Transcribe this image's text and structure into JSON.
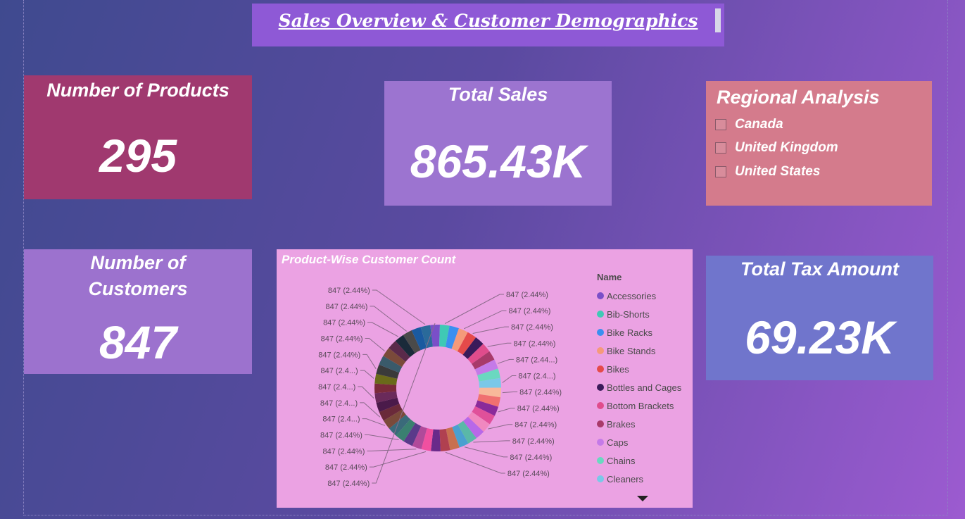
{
  "header": {
    "title": "Sales Overview & Customer Demographics"
  },
  "cards": {
    "products": {
      "title": "Number of Products",
      "value": "295"
    },
    "sales": {
      "title": "Total Sales",
      "value": "865.43K"
    },
    "customers": {
      "title_line1": "Number of",
      "title_line2": "Customers",
      "value": "847"
    },
    "tax": {
      "title": "Total Tax Amount",
      "value": "69.23K"
    }
  },
  "regional": {
    "title": "Regional Analysis",
    "options": [
      {
        "label": "Canada",
        "checked": false
      },
      {
        "label": "United Kingdom",
        "checked": false
      },
      {
        "label": "United States",
        "checked": false
      }
    ]
  },
  "chart": {
    "title": "Product-Wise Customer Count",
    "legend_title": "Name",
    "legend_items": [
      {
        "label": "Accessories",
        "color": "#7a4fc8"
      },
      {
        "label": "Bib-Shorts",
        "color": "#3fc9b5"
      },
      {
        "label": "Bike Racks",
        "color": "#3a8ff0"
      },
      {
        "label": "Bike Stands",
        "color": "#f59a7a"
      },
      {
        "label": "Bikes",
        "color": "#e54a4a"
      },
      {
        "label": "Bottles and Cages",
        "color": "#3a1a5a"
      },
      {
        "label": "Bottom Brackets",
        "color": "#e04c8c"
      },
      {
        "label": "Brakes",
        "color": "#a83a6a"
      },
      {
        "label": "Caps",
        "color": "#c47ae8"
      },
      {
        "label": "Chains",
        "color": "#6ad8c0"
      },
      {
        "label": "Cleaners",
        "color": "#7ac8e8"
      }
    ],
    "more_icon": "chevron-down-icon"
  },
  "chart_data": {
    "type": "pie",
    "variant": "donut",
    "title": "Product-Wise Customer Count",
    "legend_title": "Name",
    "categories": [
      "Accessories",
      "Bib-Shorts",
      "Bike Racks",
      "Bike Stands",
      "Bikes",
      "Bottles and Cages",
      "Bottom Brackets",
      "Brakes",
      "Caps",
      "Chains",
      "Cleaners"
    ],
    "slice_count": 41,
    "values": [
      847,
      847,
      847,
      847,
      847,
      847,
      847,
      847,
      847,
      847,
      847,
      847,
      847,
      847,
      847,
      847,
      847,
      847,
      847,
      847,
      847,
      847,
      847,
      847,
      847,
      847,
      847,
      847,
      847,
      847,
      847,
      847,
      847,
      847,
      847,
      847,
      847,
      847,
      847,
      847,
      847
    ],
    "percent_each": 2.44,
    "colors": [
      "#7a4fc8",
      "#3fc9b5",
      "#3a8ff0",
      "#f59a7a",
      "#e54a4a",
      "#3a1a5a",
      "#e04c8c",
      "#a83a6a",
      "#c47ae8",
      "#6ad8c0",
      "#7ac8e8",
      "#f8b89a",
      "#f07070",
      "#8a2a9a",
      "#e0509a",
      "#f088c0",
      "#b868e8",
      "#5ab8a8",
      "#4aa0d0",
      "#c87050",
      "#b04050",
      "#6a2a8a",
      "#f050a0",
      "#b04a9a",
      "#5a3a8a",
      "#3a8070",
      "#3a6a7a",
      "#7a4a3a",
      "#6a2a3a",
      "#4a1a4a",
      "#6a2a5a",
      "#7a2a3a",
      "#6a6a1a",
      "#3a3a3a",
      "#3a5a6a",
      "#7a4a3a",
      "#5a2a4a",
      "#1a2a3a",
      "#4a4a4a",
      "#1a5aa0",
      "#2a6a9a"
    ],
    "labels": [
      {
        "text": "847 (2.44%)",
        "side": "right"
      },
      {
        "text": "847 (2.44%)",
        "side": "right"
      },
      {
        "text": "847 (2.44%)",
        "side": "right"
      },
      {
        "text": "847 (2.44%)",
        "side": "right"
      },
      {
        "text": "847 (2.44...)",
        "side": "right"
      },
      {
        "text": "847 (2.4...)",
        "side": "right"
      },
      {
        "text": "847 (2.44%)",
        "side": "right"
      },
      {
        "text": "847 (2.44%)",
        "side": "right"
      },
      {
        "text": "847 (2.44%)",
        "side": "right"
      },
      {
        "text": "847 (2.44%)",
        "side": "right"
      },
      {
        "text": "847 (2.44%)",
        "side": "right"
      },
      {
        "text": "847 (2.44%)",
        "side": "right"
      },
      {
        "text": "847 (2.44%)",
        "side": "left"
      },
      {
        "text": "847 (2.44%)",
        "side": "left"
      },
      {
        "text": "847 (2.44%)",
        "side": "left"
      },
      {
        "text": "847 (2.44%)",
        "side": "left"
      },
      {
        "text": "847 (2.4...)",
        "side": "left"
      },
      {
        "text": "847 (2.4...)",
        "side": "left"
      },
      {
        "text": "847 (2.4...)",
        "side": "left"
      },
      {
        "text": "847 (2.4...)",
        "side": "left"
      },
      {
        "text": "847 (2.44%)",
        "side": "left"
      },
      {
        "text": "847 (2.44%)",
        "side": "left"
      },
      {
        "text": "847 (2.44%)",
        "side": "left"
      },
      {
        "text": "847 (2.44%)",
        "side": "left"
      },
      {
        "text": "847 (2.44%)",
        "side": "left"
      }
    ]
  }
}
